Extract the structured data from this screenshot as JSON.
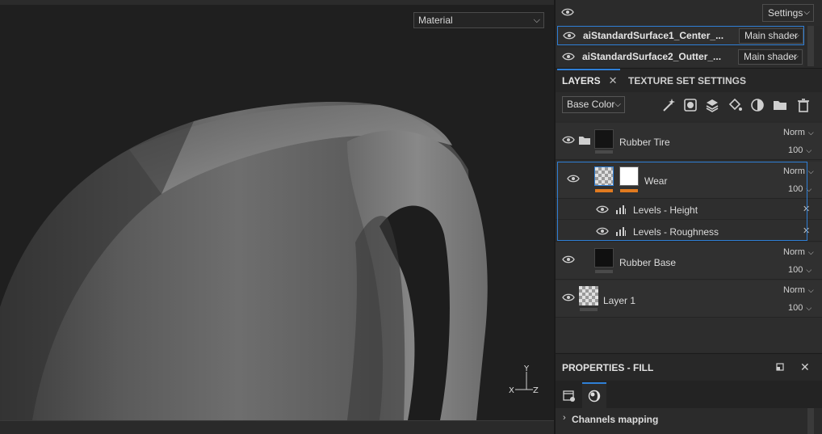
{
  "viewport": {
    "mode_select": "Material",
    "gizmo_axes": [
      "Y",
      "X",
      "Z"
    ]
  },
  "texture_set_list": {
    "settings_label": "Settings",
    "rows": [
      {
        "name": "aiStandardSurface1_Center_...",
        "shader": "Main shader",
        "selected": true
      },
      {
        "name": "aiStandardSurface2_Outter_...",
        "shader": "Main shader",
        "selected": false
      }
    ]
  },
  "tabs": [
    {
      "label": "LAYERS",
      "close": "✕"
    },
    {
      "label": "TEXTURE SET SETTINGS"
    }
  ],
  "toolbar": {
    "channel": "Base Color",
    "tools": [
      "add-effect-icon",
      "add-mask-icon",
      "add-layer-icon",
      "add-fill-icon",
      "add-smart-material-icon",
      "add-folder-icon",
      "delete-icon"
    ]
  },
  "layers": [
    {
      "name": "Rubber Tire",
      "blend": "Norm",
      "opacity": "100",
      "type": "folder"
    },
    {
      "name": "Wear",
      "blend": "Norm",
      "opacity": "100",
      "type": "fill",
      "selected": true
    },
    {
      "name": "Levels - Height",
      "type": "effect"
    },
    {
      "name": "Levels - Roughness",
      "type": "effect"
    },
    {
      "name": "Rubber Base",
      "blend": "Norm",
      "opacity": "100",
      "type": "fill"
    },
    {
      "name": "Layer 1",
      "blend": "Norm",
      "opacity": "100",
      "type": "paint"
    }
  ],
  "properties": {
    "title": "PROPERTIES - FILL",
    "section": "Channels mapping"
  },
  "colors": {
    "accent": "#2f7fd6",
    "mask_bar": "#e07a1f",
    "panel": "#2a2a2a"
  }
}
